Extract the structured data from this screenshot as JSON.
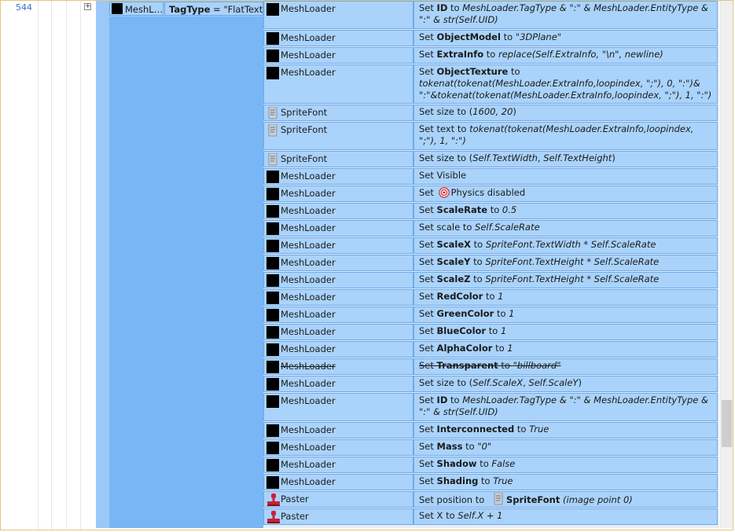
{
  "event": {
    "line_number": "544",
    "object_name": "MeshL…",
    "condition": {
      "field": "TagType",
      "operator": " = ",
      "value": "\"FlatText\""
    }
  },
  "actions": [
    {
      "object": "MeshLoader",
      "icon": "black-square-icon",
      "strike": false,
      "parts": [
        [
          "t",
          "Set "
        ],
        [
          "b",
          "ID"
        ],
        [
          "t",
          " to "
        ],
        [
          "i",
          "MeshLoader.TagType & \":\" & MeshLoader.EntityType & \":\" & str(Self.UID)"
        ]
      ]
    },
    {
      "object": "MeshLoader",
      "icon": "black-square-icon",
      "strike": false,
      "parts": [
        [
          "t",
          "Set "
        ],
        [
          "b",
          "ObjectModel"
        ],
        [
          "t",
          " to "
        ],
        [
          "i",
          "\"3DPlane\""
        ]
      ]
    },
    {
      "object": "MeshLoader",
      "icon": "black-square-icon",
      "strike": false,
      "parts": [
        [
          "t",
          "Set "
        ],
        [
          "b",
          "ExtraInfo"
        ],
        [
          "t",
          " to "
        ],
        [
          "i",
          "replace(Self.ExtraInfo, \"\\n\", newline)"
        ]
      ]
    },
    {
      "object": "MeshLoader",
      "icon": "black-square-icon",
      "strike": false,
      "parts": [
        [
          "t",
          "Set "
        ],
        [
          "b",
          "ObjectTexture"
        ],
        [
          "t",
          " to "
        ],
        [
          "i",
          "tokenat(tokenat(MeshLoader.ExtraInfo,loopindex, \";\"), 0, \":\")& \":\"&tokenat(tokenat(MeshLoader.ExtraInfo,loopindex, \";\"), 1, \":\")"
        ]
      ]
    },
    {
      "object": "SpriteFont",
      "icon": "spritefont-icon",
      "strike": false,
      "parts": [
        [
          "t",
          "Set size to ("
        ],
        [
          "i",
          "1600, 20"
        ],
        [
          "t",
          ")"
        ]
      ]
    },
    {
      "object": "SpriteFont",
      "icon": "spritefont-icon",
      "strike": false,
      "parts": [
        [
          "t",
          "Set text to "
        ],
        [
          "i",
          "tokenat(tokenat(MeshLoader.ExtraInfo,loopindex, \";\"), 1, \":\")"
        ]
      ]
    },
    {
      "object": "SpriteFont",
      "icon": "spritefont-icon",
      "strike": false,
      "parts": [
        [
          "t",
          "Set size to ("
        ],
        [
          "i",
          "Self.TextWidth"
        ],
        [
          "t",
          ", "
        ],
        [
          "i",
          "Self.TextHeight"
        ],
        [
          "t",
          ")"
        ]
      ]
    },
    {
      "object": "MeshLoader",
      "icon": "black-square-icon",
      "strike": false,
      "parts": [
        [
          "t",
          "Set Visible"
        ]
      ]
    },
    {
      "object": "MeshLoader",
      "icon": "black-square-icon",
      "strike": false,
      "parts": [
        [
          "t",
          "Set "
        ],
        [
          "g",
          "physics-gear-icon"
        ],
        [
          "t",
          "Physics disabled"
        ]
      ]
    },
    {
      "object": "MeshLoader",
      "icon": "black-square-icon",
      "strike": false,
      "parts": [
        [
          "t",
          "Set "
        ],
        [
          "b",
          "ScaleRate"
        ],
        [
          "t",
          " to "
        ],
        [
          "i",
          "0.5"
        ]
      ]
    },
    {
      "object": "MeshLoader",
      "icon": "black-square-icon",
      "strike": false,
      "parts": [
        [
          "t",
          "Set scale to "
        ],
        [
          "i",
          "Self.ScaleRate"
        ]
      ]
    },
    {
      "object": "MeshLoader",
      "icon": "black-square-icon",
      "strike": false,
      "parts": [
        [
          "t",
          "Set "
        ],
        [
          "b",
          "ScaleX"
        ],
        [
          "t",
          " to "
        ],
        [
          "i",
          "SpriteFont.TextWidth * Self.ScaleRate"
        ]
      ]
    },
    {
      "object": "MeshLoader",
      "icon": "black-square-icon",
      "strike": false,
      "parts": [
        [
          "t",
          "Set "
        ],
        [
          "b",
          "ScaleY"
        ],
        [
          "t",
          " to "
        ],
        [
          "i",
          "SpriteFont.TextHeight * Self.ScaleRate"
        ]
      ]
    },
    {
      "object": "MeshLoader",
      "icon": "black-square-icon",
      "strike": false,
      "parts": [
        [
          "t",
          "Set "
        ],
        [
          "b",
          "ScaleZ"
        ],
        [
          "t",
          " to "
        ],
        [
          "i",
          "SpriteFont.TextHeight * Self.ScaleRate"
        ]
      ]
    },
    {
      "object": "MeshLoader",
      "icon": "black-square-icon",
      "strike": false,
      "parts": [
        [
          "t",
          "Set "
        ],
        [
          "b",
          "RedColor"
        ],
        [
          "t",
          " to "
        ],
        [
          "i",
          "1"
        ]
      ]
    },
    {
      "object": "MeshLoader",
      "icon": "black-square-icon",
      "strike": false,
      "parts": [
        [
          "t",
          "Set "
        ],
        [
          "b",
          "GreenColor"
        ],
        [
          "t",
          " to "
        ],
        [
          "i",
          "1"
        ]
      ]
    },
    {
      "object": "MeshLoader",
      "icon": "black-square-icon",
      "strike": false,
      "parts": [
        [
          "t",
          "Set "
        ],
        [
          "b",
          "BlueColor"
        ],
        [
          "t",
          " to "
        ],
        [
          "i",
          "1"
        ]
      ]
    },
    {
      "object": "MeshLoader",
      "icon": "black-square-icon",
      "strike": false,
      "parts": [
        [
          "t",
          "Set "
        ],
        [
          "b",
          "AlphaColor"
        ],
        [
          "t",
          " to "
        ],
        [
          "i",
          "1"
        ]
      ]
    },
    {
      "object": "MeshLoader",
      "icon": "black-square-icon",
      "strike": true,
      "parts": [
        [
          "t",
          "Set "
        ],
        [
          "b",
          "Transparent"
        ],
        [
          "t",
          " to "
        ],
        [
          "i",
          "\"billboard\""
        ]
      ]
    },
    {
      "object": "MeshLoader",
      "icon": "black-square-icon",
      "strike": false,
      "parts": [
        [
          "t",
          "Set size to ("
        ],
        [
          "i",
          "Self.ScaleX"
        ],
        [
          "t",
          ", "
        ],
        [
          "i",
          "Self.ScaleY"
        ],
        [
          "t",
          ")"
        ]
      ]
    },
    {
      "object": "MeshLoader",
      "icon": "black-square-icon",
      "strike": false,
      "parts": [
        [
          "t",
          "Set "
        ],
        [
          "b",
          "ID"
        ],
        [
          "t",
          " to "
        ],
        [
          "i",
          "MeshLoader.TagType & \":\" & MeshLoader.EntityType & \":\" & str(Self.UID)"
        ]
      ]
    },
    {
      "object": "MeshLoader",
      "icon": "black-square-icon",
      "strike": false,
      "parts": [
        [
          "t",
          "Set "
        ],
        [
          "b",
          "Interconnected"
        ],
        [
          "t",
          " to "
        ],
        [
          "i",
          "True"
        ]
      ]
    },
    {
      "object": "MeshLoader",
      "icon": "black-square-icon",
      "strike": false,
      "parts": [
        [
          "t",
          "Set "
        ],
        [
          "b",
          "Mass"
        ],
        [
          "t",
          " to "
        ],
        [
          "i",
          "\"0\""
        ]
      ]
    },
    {
      "object": "MeshLoader",
      "icon": "black-square-icon",
      "strike": false,
      "parts": [
        [
          "t",
          "Set "
        ],
        [
          "b",
          "Shadow"
        ],
        [
          "t",
          " to "
        ],
        [
          "i",
          "False"
        ]
      ]
    },
    {
      "object": "MeshLoader",
      "icon": "black-square-icon",
      "strike": false,
      "parts": [
        [
          "t",
          "Set "
        ],
        [
          "b",
          "Shading"
        ],
        [
          "t",
          " to "
        ],
        [
          "i",
          "True"
        ]
      ]
    },
    {
      "object": "Paster",
      "icon": "paster-stamp-icon",
      "strike": false,
      "parts": [
        [
          "t",
          "Set position to "
        ],
        [
          "f",
          "spritefont-icon"
        ],
        [
          "b",
          "SpriteFont"
        ],
        [
          "t",
          " "
        ],
        [
          "i",
          "(image point 0)"
        ]
      ]
    },
    {
      "object": "Paster",
      "icon": "paster-stamp-icon",
      "strike": false,
      "parts": [
        [
          "t",
          "Set X to "
        ],
        [
          "i",
          "Self.X + 1"
        ]
      ]
    }
  ],
  "colors": {
    "event_body": "#78b6f6",
    "action_cell": "#aad3fb",
    "cell_border": "#6fa9e6",
    "line_number": "#3a72c4"
  }
}
